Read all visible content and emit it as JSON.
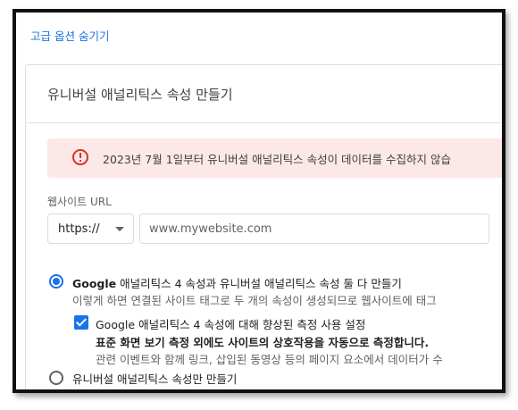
{
  "advanced_link": "고급 옵션 숨기기",
  "card": {
    "title": "유니버설 애널리틱스 속성 만들기"
  },
  "alert": {
    "icon": "error-outline-icon",
    "text": "2023년 7월 1일부터 유니버설 애널리틱스 속성이 데이터를 수집하지 않습"
  },
  "url": {
    "label": "웹사이트 URL",
    "protocol": "https://",
    "placeholder": "www.mywebsite.com"
  },
  "option_both": {
    "label_bold": "Google",
    "label_rest": " 애널리틱스 4 속성과 유니버설 애널리틱스 속성 둘 다 만들기",
    "description": "이렇게 하면 연결된 사이트 태그로 두 개의 속성이 생성되므로 웹사이트에 태그"
  },
  "enhanced_measurement": {
    "label_bold": "Google",
    "label_rest": " 애널리틱스 4 속성에 대해 향상된 측정 사용 설정",
    "description_1": "표준 화면 보기 측정 외에도 사이트의 상호작용을 자동으로 측정합니다.",
    "description_2": "관련 이벤트와 함께 링크, 삽입된 동영상 등의 페이지 요소에서 데이터가 수"
  },
  "option_ua_only": {
    "label": "유니버설 애널리틱스 속성만 만들기"
  },
  "colors": {
    "accent": "#1a73e8",
    "alert_bg": "#fce8e6",
    "alert_icon": "#d93025"
  }
}
